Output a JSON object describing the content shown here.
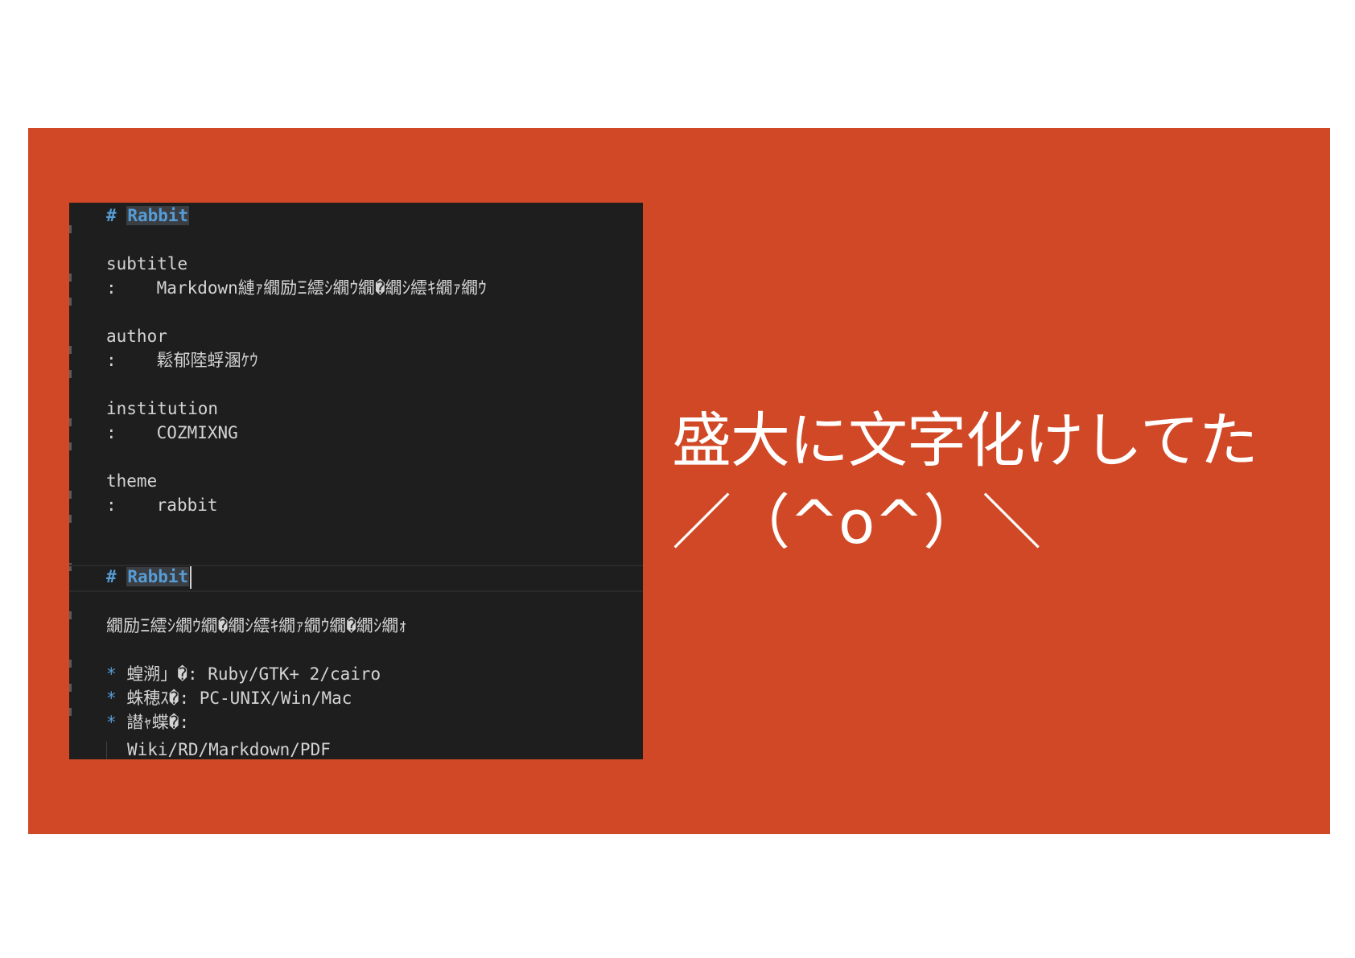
{
  "editor": {
    "heading1": {
      "hash": "#",
      "title": "Rabbit"
    },
    "subtitle": {
      "key": "subtitle",
      "colon": ":",
      "value": "Markdown縺ｧ繝励Ξ繧ｼ繝ｳ繝�繝ｼ繧ｷ繝ｧ繝ｳ"
    },
    "author": {
      "key": "author",
      "colon": ":",
      "value": "鬆郁陸蜉溷ｹｳ"
    },
    "institution": {
      "key": "institution",
      "colon": ":",
      "value": "COZMIXNG"
    },
    "theme": {
      "key": "theme",
      "colon": ":",
      "value": "rabbit"
    },
    "heading2": {
      "hash": "#",
      "title": "Rabbit"
    },
    "body_text": "繝励Ξ繧ｼ繝ｳ繝�繝ｼ繧ｷ繝ｧ繝ｳ繝�繝ｼ繝ｫ",
    "bullets": [
      {
        "mark": "*",
        "text": "蝗溯」�: Ruby/GTK+ 2/cairo"
      },
      {
        "mark": "*",
        "text": "蛛穂ｽ�: PC-UNIX/Win/Mac"
      },
      {
        "mark": "*",
        "text": "譛ｬ蝶�:"
      }
    ],
    "continuation": "Wiki/RD/Markdown/PDF"
  },
  "caption": {
    "line1": "盛大に文字化けしてた",
    "line2": "／（^o^）＼"
  },
  "colors": {
    "slide_background": "#d14826",
    "editor_background": "#1e1e1e",
    "heading_blue": "#569cd6",
    "text": "#d4d4d4"
  }
}
